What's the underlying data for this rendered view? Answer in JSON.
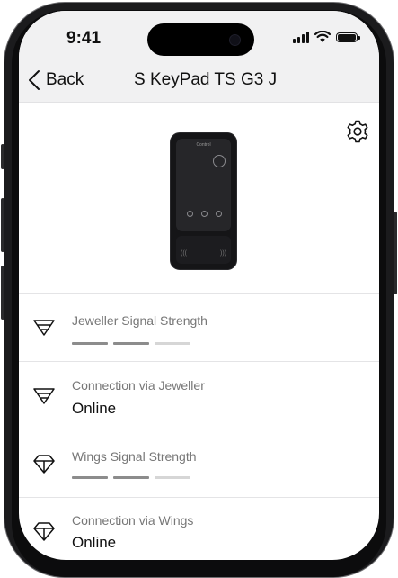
{
  "status_bar": {
    "time": "9:41"
  },
  "nav": {
    "back_label": "Back",
    "title": "S KeyPad TS G3 J"
  },
  "device_image": {
    "screen_text": "Control"
  },
  "rows": [
    {
      "label": "Jeweller Signal Strength",
      "icon": "jeweller-signal-icon",
      "signal": 2,
      "signal_max": 3
    },
    {
      "label": "Connection via Jeweller",
      "icon": "jeweller-connection-icon",
      "value": "Online"
    },
    {
      "label": "Wings Signal Strength",
      "icon": "wings-signal-icon",
      "signal": 2,
      "signal_max": 3
    },
    {
      "label": "Connection via Wings",
      "icon": "wings-connection-icon",
      "value": "Online"
    }
  ],
  "colors": {
    "signal_active": "#8c8c8c",
    "signal_inactive": "#d6d6d6",
    "background": "#ffffff",
    "header": "#f1f1f2"
  }
}
